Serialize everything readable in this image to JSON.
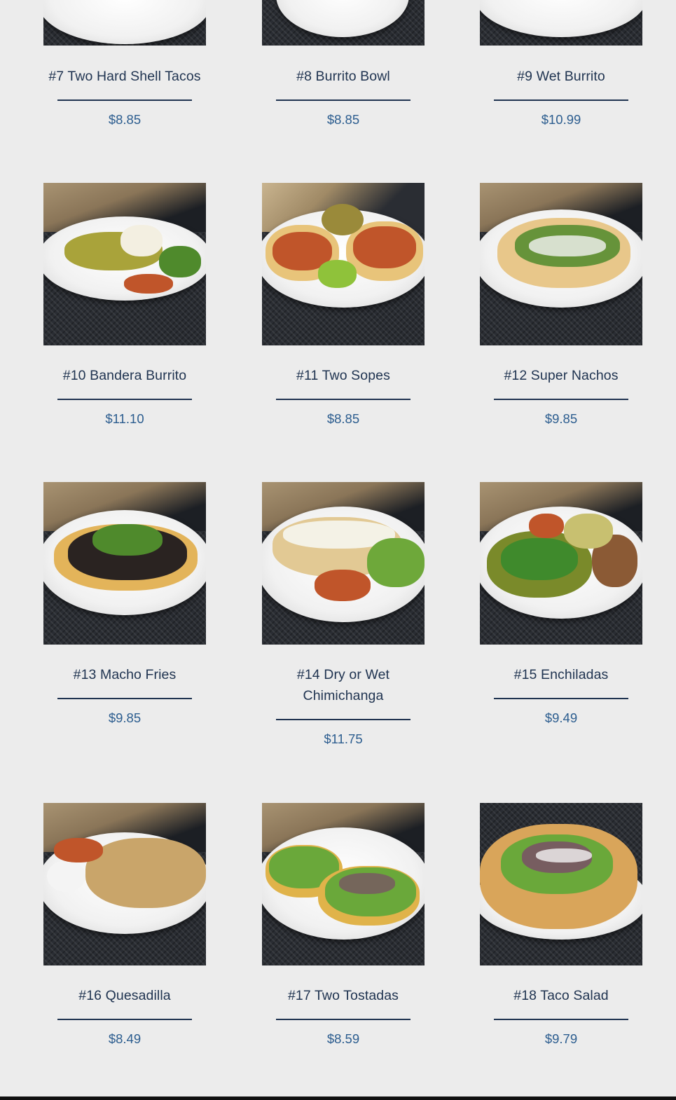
{
  "menu": {
    "items": [
      {
        "name": "#7 Two Hard Shell Tacos",
        "price": "$8.85",
        "food_color": "#2b2320",
        "food_color2": "#6b4a2e"
      },
      {
        "name": "#8 Burrito Bowl",
        "price": "$8.85",
        "food_color": "#6b3e22",
        "food_color2": "#d9d3c4"
      },
      {
        "name": "#9 Wet Burrito",
        "price": "$10.99",
        "food_color": "#c26a1c",
        "food_color2": "#e9e3d3"
      },
      {
        "name": "#10 Bandera Burrito",
        "price": "$11.10",
        "food_color": "#a9a33a",
        "food_color2": "#f3efe1"
      },
      {
        "name": "#11 Two Sopes",
        "price": "$8.85",
        "food_color": "#c0552a",
        "food_color2": "#e8c47a"
      },
      {
        "name": "#12 Super Nachos",
        "price": "$9.85",
        "food_color": "#e8c78a",
        "food_color2": "#4f8a2c"
      },
      {
        "name": "#13 Macho Fries",
        "price": "$9.85",
        "food_color": "#2a2321",
        "food_color2": "#e3b45a"
      },
      {
        "name": "#14 Dry or Wet Chimichanga",
        "price": "$11.75",
        "food_color": "#e2c994",
        "food_color2": "#6ea83a"
      },
      {
        "name": "#15 Enchiladas",
        "price": "$9.49",
        "food_color": "#7a8a2a",
        "food_color2": "#8b5a35"
      },
      {
        "name": "#16 Quesadilla",
        "price": "$8.49",
        "food_color": "#c9a56a",
        "food_color2": "#f4f4f4"
      },
      {
        "name": "#17 Two Tostadas",
        "price": "$8.59",
        "food_color": "#6aa83a",
        "food_color2": "#e0b34a"
      },
      {
        "name": "#18 Taco Salad",
        "price": "$9.79",
        "food_color": "#d9a55a",
        "food_color2": "#7a4a6a"
      }
    ]
  }
}
